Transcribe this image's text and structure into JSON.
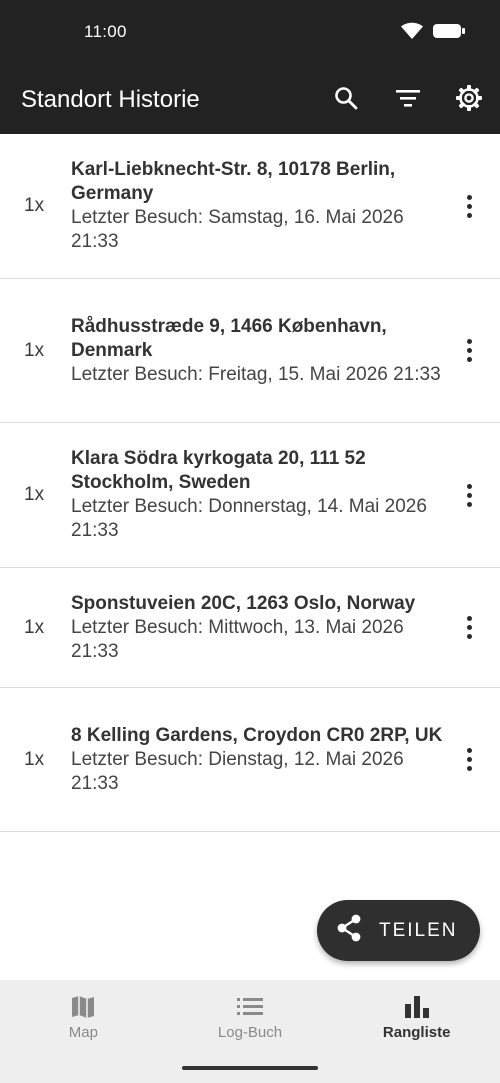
{
  "status_bar": {
    "time": "11:00"
  },
  "app_bar": {
    "title": "Standort Historie",
    "actions": [
      "search-icon",
      "filter-icon",
      "settings-icon"
    ]
  },
  "locations": [
    {
      "count": "1x",
      "address": "Karl-Liebknecht-Str. 8, 10178 Berlin, Germany",
      "last_visit": "Letzter Besuch: Samstag, 16. Mai 2026 21:33"
    },
    {
      "count": "1x",
      "address": "Rådhusstræde 9, 1466 København, Denmark",
      "last_visit": "Letzter Besuch: Freitag, 15. Mai 2026 21:33"
    },
    {
      "count": "1x",
      "address": "Klara Södra kyrkogata 20, 111 52 Stockholm, Sweden",
      "last_visit": "Letzter Besuch: Donnerstag, 14. Mai 2026 21:33"
    },
    {
      "count": "1x",
      "address": "Sponstuveien 20C, 1263 Oslo, Norway",
      "last_visit": "Letzter Besuch: Mittwoch, 13. Mai 2026 21:33"
    },
    {
      "count": "1x",
      "address": "8 Kelling Gardens, Croydon CR0 2RP, UK",
      "last_visit": "Letzter Besuch: Dienstag, 12. Mai 2026 21:33"
    }
  ],
  "fab": {
    "label": "TEILEN",
    "icon": "share-icon"
  },
  "bottom_nav": {
    "items": [
      {
        "label": "Map",
        "icon": "map-icon",
        "active": false
      },
      {
        "label": "Log-Buch",
        "icon": "list-icon",
        "active": false
      },
      {
        "label": "Rangliste",
        "icon": "bar-chart-icon",
        "active": true
      }
    ]
  },
  "colors": {
    "bar_bg": "#222222",
    "fab_bg": "#2f2f2f",
    "nav_bg": "#eeeeee"
  }
}
